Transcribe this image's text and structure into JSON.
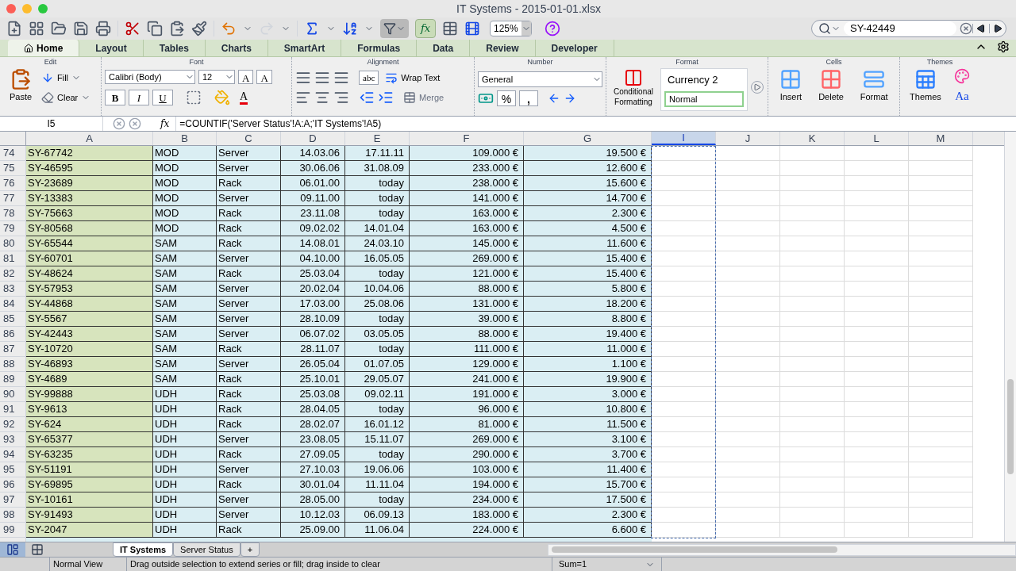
{
  "window": {
    "title": "IT Systems - 2015-01-01.xlsx"
  },
  "toolbar": {
    "formula_builder": "fx",
    "zoom": "125%",
    "search": {
      "value": "SY-42449"
    }
  },
  "ribbon_tabs": [
    {
      "label": "Home",
      "selected": true
    },
    {
      "label": "Layout",
      "selected": false
    },
    {
      "label": "Tables",
      "selected": false
    },
    {
      "label": "Charts",
      "selected": false
    },
    {
      "label": "SmartArt",
      "selected": false
    },
    {
      "label": "Formulas",
      "selected": false
    },
    {
      "label": "Data",
      "selected": false
    },
    {
      "label": "Review",
      "selected": false
    },
    {
      "label": "Developer",
      "selected": false
    }
  ],
  "ribbon": {
    "edit": {
      "title": "Edit",
      "paste": "Paste",
      "fill": "Fill",
      "clear": "Clear"
    },
    "font": {
      "title": "Font",
      "family": "Calibri (Body)",
      "size": "12",
      "grow": "A",
      "shrink": "A",
      "bold": "B",
      "italic": "I",
      "underline": "U",
      "color_letter": "A"
    },
    "alignment": {
      "title": "Alignment",
      "orientation": "abc",
      "wrap": "Wrap Text",
      "merge": "Merge"
    },
    "number": {
      "title": "Number",
      "format": "General",
      "percent": "%",
      "comma": ","
    },
    "format": {
      "title": "Format",
      "conditional": "Conditional Formatting",
      "styles": [
        {
          "label": "Currency 2",
          "selected": false
        },
        {
          "label": "Normal",
          "selected": true
        }
      ]
    },
    "cells": {
      "title": "Cells",
      "insert": "Insert",
      "delete": "Delete",
      "format": "Format"
    },
    "themes": {
      "title": "Themes",
      "themes": "Themes",
      "fonts": "Aa"
    }
  },
  "formula_bar": {
    "name_box": "I5",
    "fx": "fx",
    "formula": "=COUNTIF('Server Status'!A:A;'IT Systems'!A5)"
  },
  "columns": [
    {
      "letter": "A",
      "selected": false
    },
    {
      "letter": "B",
      "selected": false
    },
    {
      "letter": "C",
      "selected": false
    },
    {
      "letter": "D",
      "selected": false
    },
    {
      "letter": "E",
      "selected": false
    },
    {
      "letter": "F",
      "selected": false
    },
    {
      "letter": "G",
      "selected": false
    },
    {
      "letter": "I",
      "selected": true
    },
    {
      "letter": "J",
      "selected": false
    },
    {
      "letter": "K",
      "selected": false
    },
    {
      "letter": "L",
      "selected": false
    },
    {
      "letter": "M",
      "selected": false
    }
  ],
  "rows": [
    {
      "number": "74",
      "cells": [
        "SY-67742",
        "MOD",
        "Server",
        "14.03.06",
        "17.11.11",
        "109.000 €",
        "19.500 €"
      ]
    },
    {
      "number": "75",
      "cells": [
        "SY-46595",
        "MOD",
        "Server",
        "30.06.06",
        "31.08.09",
        "233.000 €",
        "12.600 €"
      ]
    },
    {
      "number": "76",
      "cells": [
        "SY-23689",
        "MOD",
        "Rack",
        "06.01.00",
        "today",
        "238.000 €",
        "15.600 €"
      ]
    },
    {
      "number": "77",
      "cells": [
        "SY-13383",
        "MOD",
        "Server",
        "09.11.00",
        "today",
        "141.000 €",
        "14.700 €"
      ]
    },
    {
      "number": "78",
      "cells": [
        "SY-75663",
        "MOD",
        "Rack",
        "23.11.08",
        "today",
        "163.000 €",
        "2.300 €"
      ]
    },
    {
      "number": "79",
      "cells": [
        "SY-80568",
        "MOD",
        "Rack",
        "09.02.02",
        "14.01.04",
        "163.000 €",
        "4.500 €"
      ]
    },
    {
      "number": "80",
      "cells": [
        "SY-65544",
        "SAM",
        "Rack",
        "14.08.01",
        "24.03.10",
        "145.000 €",
        "11.600 €"
      ]
    },
    {
      "number": "81",
      "cells": [
        "SY-60701",
        "SAM",
        "Server",
        "04.10.00",
        "16.05.05",
        "269.000 €",
        "15.400 €"
      ]
    },
    {
      "number": "82",
      "cells": [
        "SY-48624",
        "SAM",
        "Rack",
        "25.03.04",
        "today",
        "121.000 €",
        "15.400 €"
      ]
    },
    {
      "number": "83",
      "cells": [
        "SY-57953",
        "SAM",
        "Server",
        "20.02.04",
        "10.04.06",
        "88.000 €",
        "5.800 €"
      ]
    },
    {
      "number": "84",
      "cells": [
        "SY-44868",
        "SAM",
        "Server",
        "17.03.00",
        "25.08.06",
        "131.000 €",
        "18.200 €"
      ]
    },
    {
      "number": "85",
      "cells": [
        "SY-5567",
        "SAM",
        "Server",
        "28.10.09",
        "today",
        "39.000 €",
        "8.800 €"
      ]
    },
    {
      "number": "86",
      "cells": [
        "SY-42443",
        "SAM",
        "Server",
        "06.07.02",
        "03.05.05",
        "88.000 €",
        "19.400 €"
      ]
    },
    {
      "number": "87",
      "cells": [
        "SY-10720",
        "SAM",
        "Rack",
        "28.11.07",
        "today",
        "111.000 €",
        "11.000 €"
      ]
    },
    {
      "number": "88",
      "cells": [
        "SY-46893",
        "SAM",
        "Server",
        "26.05.04",
        "01.07.05",
        "129.000 €",
        "1.100 €"
      ]
    },
    {
      "number": "89",
      "cells": [
        "SY-4689",
        "SAM",
        "Rack",
        "25.10.01",
        "29.05.07",
        "241.000 €",
        "19.900 €"
      ]
    },
    {
      "number": "90",
      "cells": [
        "SY-99888",
        "UDH",
        "Rack",
        "25.03.08",
        "09.02.11",
        "191.000 €",
        "3.000 €"
      ]
    },
    {
      "number": "91",
      "cells": [
        "SY-9613",
        "UDH",
        "Rack",
        "28.04.05",
        "today",
        "96.000 €",
        "10.800 €"
      ]
    },
    {
      "number": "92",
      "cells": [
        "SY-624",
        "UDH",
        "Rack",
        "28.02.07",
        "16.01.12",
        "81.000 €",
        "11.500 €"
      ]
    },
    {
      "number": "93",
      "cells": [
        "SY-65377",
        "UDH",
        "Server",
        "23.08.05",
        "15.11.07",
        "269.000 €",
        "3.100 €"
      ]
    },
    {
      "number": "94",
      "cells": [
        "SY-63235",
        "UDH",
        "Rack",
        "27.09.05",
        "today",
        "290.000 €",
        "3.700 €"
      ]
    },
    {
      "number": "95",
      "cells": [
        "SY-51191",
        "UDH",
        "Server",
        "27.10.03",
        "19.06.06",
        "103.000 €",
        "11.400 €"
      ]
    },
    {
      "number": "96",
      "cells": [
        "SY-69895",
        "UDH",
        "Rack",
        "30.01.04",
        "11.11.04",
        "194.000 €",
        "15.700 €"
      ]
    },
    {
      "number": "97",
      "cells": [
        "SY-10161",
        "UDH",
        "Server",
        "28.05.00",
        "today",
        "234.000 €",
        "17.500 €"
      ]
    },
    {
      "number": "98",
      "cells": [
        "SY-91493",
        "UDH",
        "Server",
        "10.12.03",
        "06.09.13",
        "183.000 €",
        "2.300 €"
      ]
    },
    {
      "number": "99",
      "cells": [
        "SY-2047",
        "UDH",
        "Rack",
        "25.09.00",
        "11.06.04",
        "224.000 €",
        "6.600 €"
      ]
    }
  ],
  "sheet_tabs": [
    {
      "label": "IT Systems",
      "selected": true
    },
    {
      "label": "Server Status",
      "selected": false
    }
  ],
  "add_sheet": "+",
  "status_bar": {
    "view": "Normal View",
    "message": "Drag outside selection to extend series or fill; drag inside to clear",
    "sum": "Sum=1"
  }
}
